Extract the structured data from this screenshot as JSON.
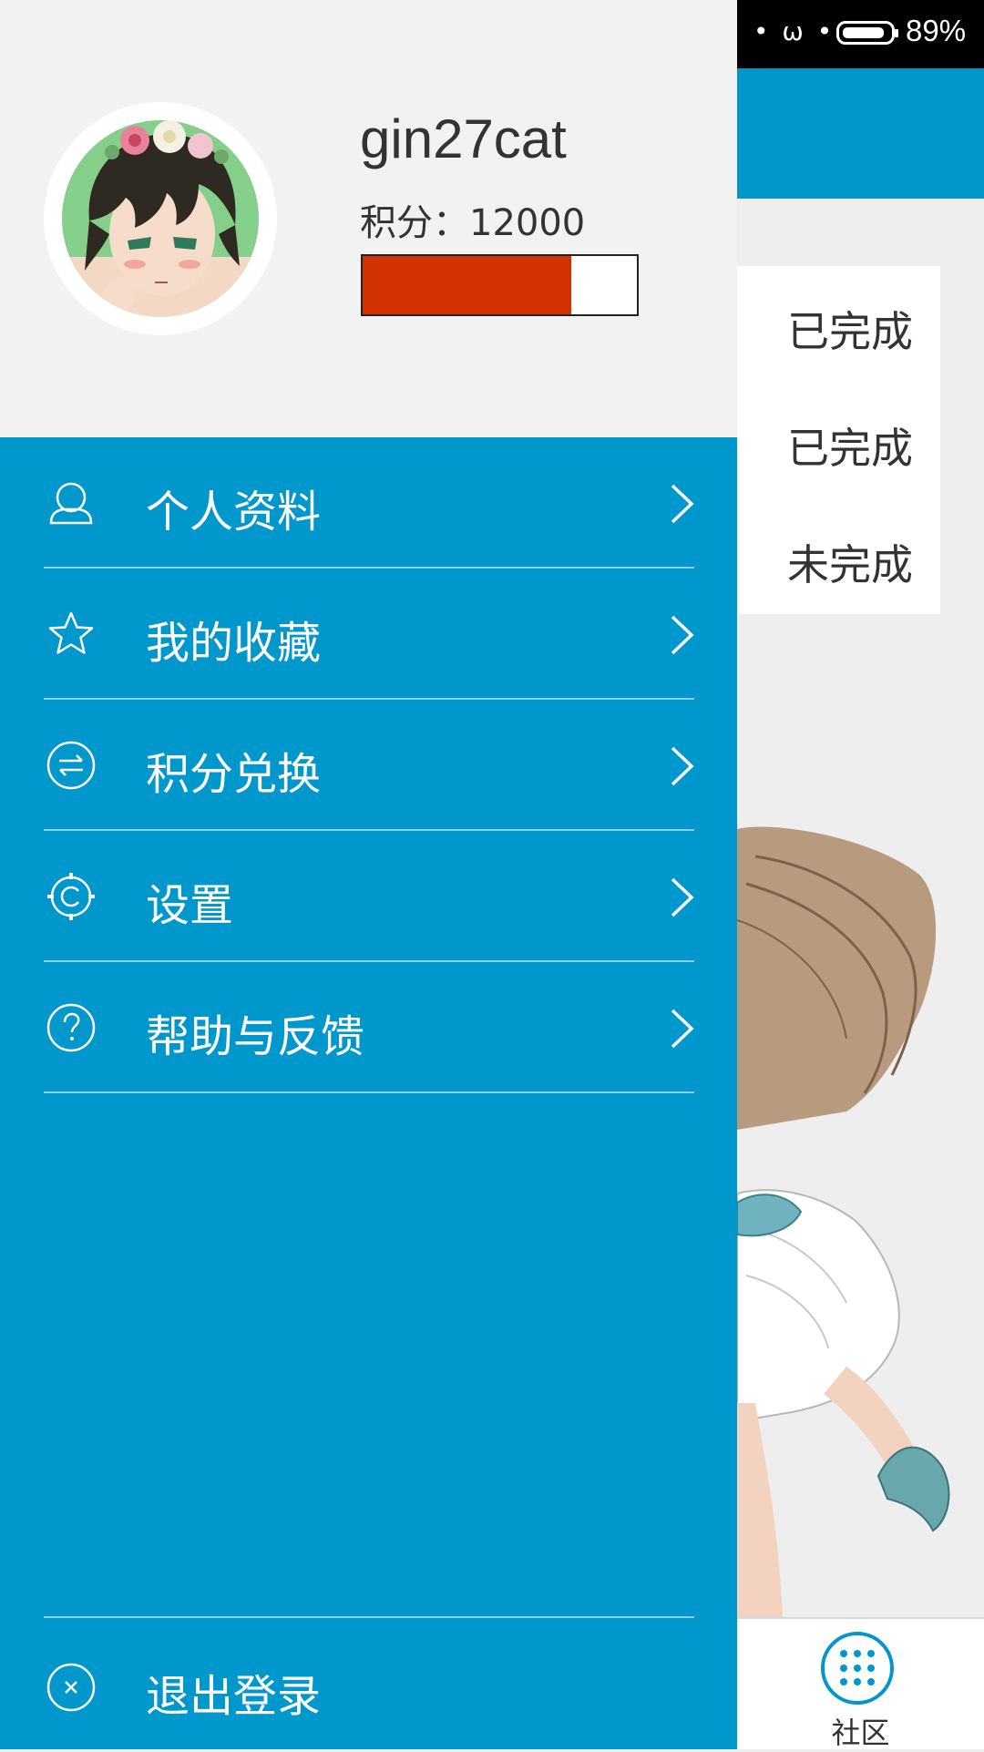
{
  "status_bar": {
    "indicator": "• ω •",
    "battery": "89%",
    "battery_level": 0.89
  },
  "main": {
    "task_status": [
      "已完成",
      "已完成",
      "未完成"
    ],
    "bottom_nav": {
      "label": "社区",
      "icon": "grid-dots-icon"
    }
  },
  "drawer": {
    "user": {
      "name": "gin27cat",
      "points_text": "积分：12000",
      "progress_value": 0.76,
      "progress_color": "#d13200"
    },
    "menu": [
      {
        "label": "个人资料",
        "icon": "user-icon"
      },
      {
        "label": "我的收藏",
        "icon": "star-icon"
      },
      {
        "label": "积分兑换",
        "icon": "exchange-icon"
      },
      {
        "label": "设置",
        "icon": "settings-icon"
      },
      {
        "label": "帮助与反馈",
        "icon": "help-icon"
      }
    ],
    "logout": {
      "label": "退出登录",
      "icon": "close-circle-icon"
    }
  },
  "colors": {
    "accent": "#0098cc",
    "header_bg": "#f2f2f2",
    "progress": "#d13200"
  }
}
